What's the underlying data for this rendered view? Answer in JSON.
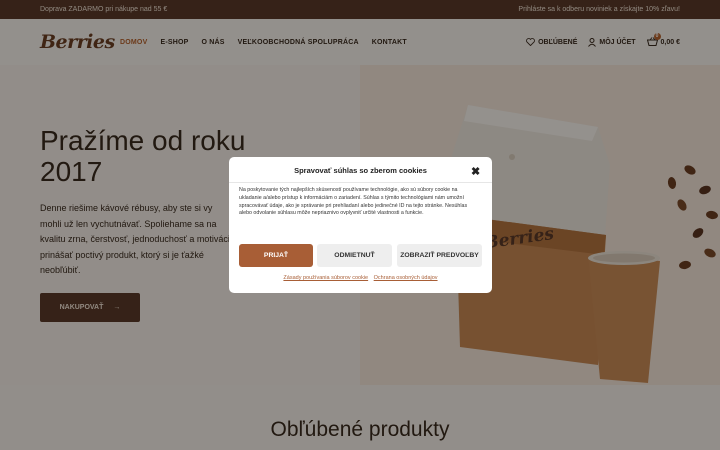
{
  "topbar": {
    "left_text": "Doprava ZADARMO pri nákupe nad 55 €",
    "right_text": "Prihláste sa k odberu noviniek a získajte 10% zľavu!"
  },
  "header": {
    "logo": "Berries",
    "nav": [
      "DOMOV",
      "E-SHOP",
      "O NÁS",
      "VEĽKOOBCHODNÁ SPOLUPRÁCA",
      "KONTAKT"
    ],
    "active_nav": "DOMOV",
    "favorites_label": "OBĽÚBENÉ",
    "account_label": "MÔJ ÚČET",
    "cart_total": "0,00 €",
    "cart_count": "0"
  },
  "hero": {
    "title": "Pražíme od roku 2017",
    "text": "Denne riešime kávové rébusy, aby ste si vy mohli už len vychutnávať. Spoliehame sa na kvalitu zrna, čerstvosť, jednoduchosť a motiváciu prinášať poctivý produkt, ktorý si je ťažké neobľúbiť.",
    "button_label": "NAKUPOVAŤ",
    "bag_logo": "Berries"
  },
  "section": {
    "title": "Obľúbené produkty"
  },
  "cookie_modal": {
    "title": "Spravovať súhlas so zberom cookies",
    "body": "Na poskytovanie tých najlepších skúseností používame technológie, ako sú súbory cookie na ukladanie a/alebo prístup k informáciám o zariadení. Súhlas s týmito technológiami nám umožní spracovávať údaje, ako je správanie pri prehliadaní alebo jedinečné ID na tejto stránke. Nesúhlas alebo odvolanie súhlasu môže nepriaznivo ovplyvniť určité vlastnosti a funkcie.",
    "accept_label": "PRIJAŤ",
    "deny_label": "ODMIETNUŤ",
    "prefs_label": "ZOBRAZIŤ PREDVOĽBY",
    "links": [
      "Zásady používania súborov cookie",
      "Ochrana osobných údajov"
    ]
  },
  "colors": {
    "brand_dark": "#5a3a28",
    "accent": "#b4612c",
    "accept_button": "#a85e36"
  }
}
